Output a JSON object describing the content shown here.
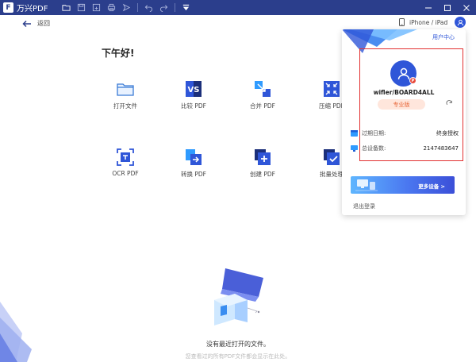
{
  "app": {
    "title": "万兴PDF",
    "logo_letter": "F"
  },
  "nav": {
    "back_label": "返回"
  },
  "greeting": "下午好!",
  "tools": [
    {
      "label": "打开文件"
    },
    {
      "label": "比较 PDF"
    },
    {
      "label": "合并 PDF"
    },
    {
      "label": "压缩 PDF"
    },
    {
      "label": "OCR PDF"
    },
    {
      "label": "转换 PDF"
    },
    {
      "label": "创建 PDF"
    },
    {
      "label": "批量处理"
    }
  ],
  "empty_state": {
    "message": "没有最近打开的文件。",
    "hint": "您查看过的所有PDF文件都会显示在此处。"
  },
  "topbar": {
    "device_label": "iPhone / iPad"
  },
  "panel": {
    "user_center": "用户中心",
    "avatar_badge": "P",
    "username": "wifler/BOARD4ALL",
    "plan": "专业版",
    "expiry_label": "过期日期:",
    "expiry_value": "终身授权",
    "devices_label": "总设备数:",
    "devices_value": "2147483647",
    "more_devices": "更多设备 >",
    "logout": "退出登录"
  },
  "colors": {
    "titlebar": "#2b3e8c",
    "accent": "#2f56d8",
    "highlight_border": "#e23030",
    "pro_badge_text": "#e8693c"
  }
}
